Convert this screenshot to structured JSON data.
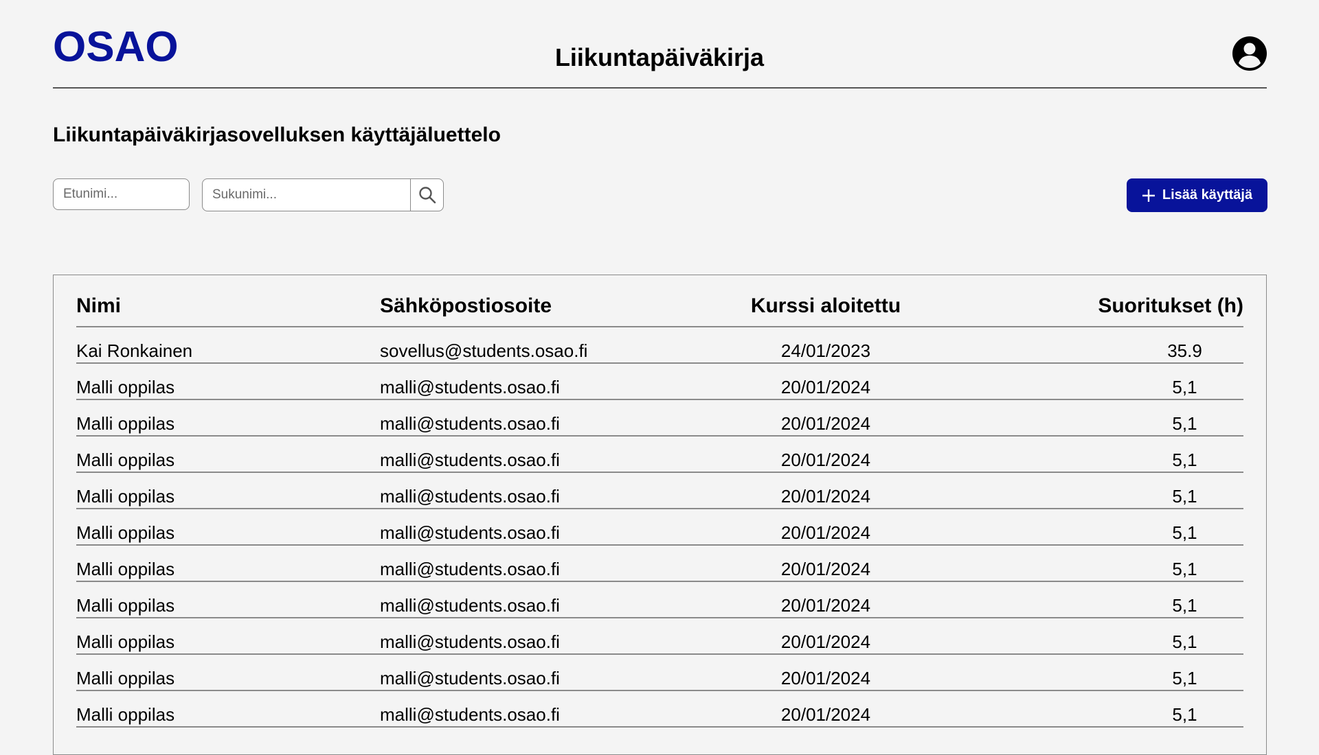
{
  "header": {
    "logo": "OSAO",
    "title": "Liikuntapäiväkirja"
  },
  "page": {
    "heading": "Liikuntapäiväkirjasovelluksen käyttäjäluettelo"
  },
  "filters": {
    "first_name_placeholder": "Etunimi...",
    "last_name_placeholder": "Sukunimi..."
  },
  "actions": {
    "add_user_label": "Lisää käyttäjä"
  },
  "colors": {
    "brand": "#08139a",
    "background": "#f4f4f4"
  },
  "icons": {
    "user": "account-circle-icon",
    "search": "search-icon",
    "add": "plus-icon"
  },
  "table": {
    "headers": [
      "Nimi",
      "Sähköpostiosoite",
      "Kurssi aloitettu",
      "Suoritukset (h)"
    ],
    "rows": [
      {
        "name": "Kai Ronkainen",
        "email": "sovellus@students.osao.fi",
        "started": "24/01/2023",
        "hours": "35.9"
      },
      {
        "name": "Malli oppilas",
        "email": "malli@students.osao.fi",
        "started": "20/01/2024",
        "hours": "5,1"
      },
      {
        "name": "Malli oppilas",
        "email": "malli@students.osao.fi",
        "started": "20/01/2024",
        "hours": "5,1"
      },
      {
        "name": "Malli oppilas",
        "email": "malli@students.osao.fi",
        "started": "20/01/2024",
        "hours": "5,1"
      },
      {
        "name": "Malli oppilas",
        "email": "malli@students.osao.fi",
        "started": "20/01/2024",
        "hours": "5,1"
      },
      {
        "name": "Malli oppilas",
        "email": "malli@students.osao.fi",
        "started": "20/01/2024",
        "hours": "5,1"
      },
      {
        "name": "Malli oppilas",
        "email": "malli@students.osao.fi",
        "started": "20/01/2024",
        "hours": "5,1"
      },
      {
        "name": "Malli oppilas",
        "email": "malli@students.osao.fi",
        "started": "20/01/2024",
        "hours": "5,1"
      },
      {
        "name": "Malli oppilas",
        "email": "malli@students.osao.fi",
        "started": "20/01/2024",
        "hours": "5,1"
      },
      {
        "name": "Malli oppilas",
        "email": "malli@students.osao.fi",
        "started": "20/01/2024",
        "hours": "5,1"
      },
      {
        "name": "Malli oppilas",
        "email": "malli@students.osao.fi",
        "started": "20/01/2024",
        "hours": "5,1"
      }
    ]
  }
}
